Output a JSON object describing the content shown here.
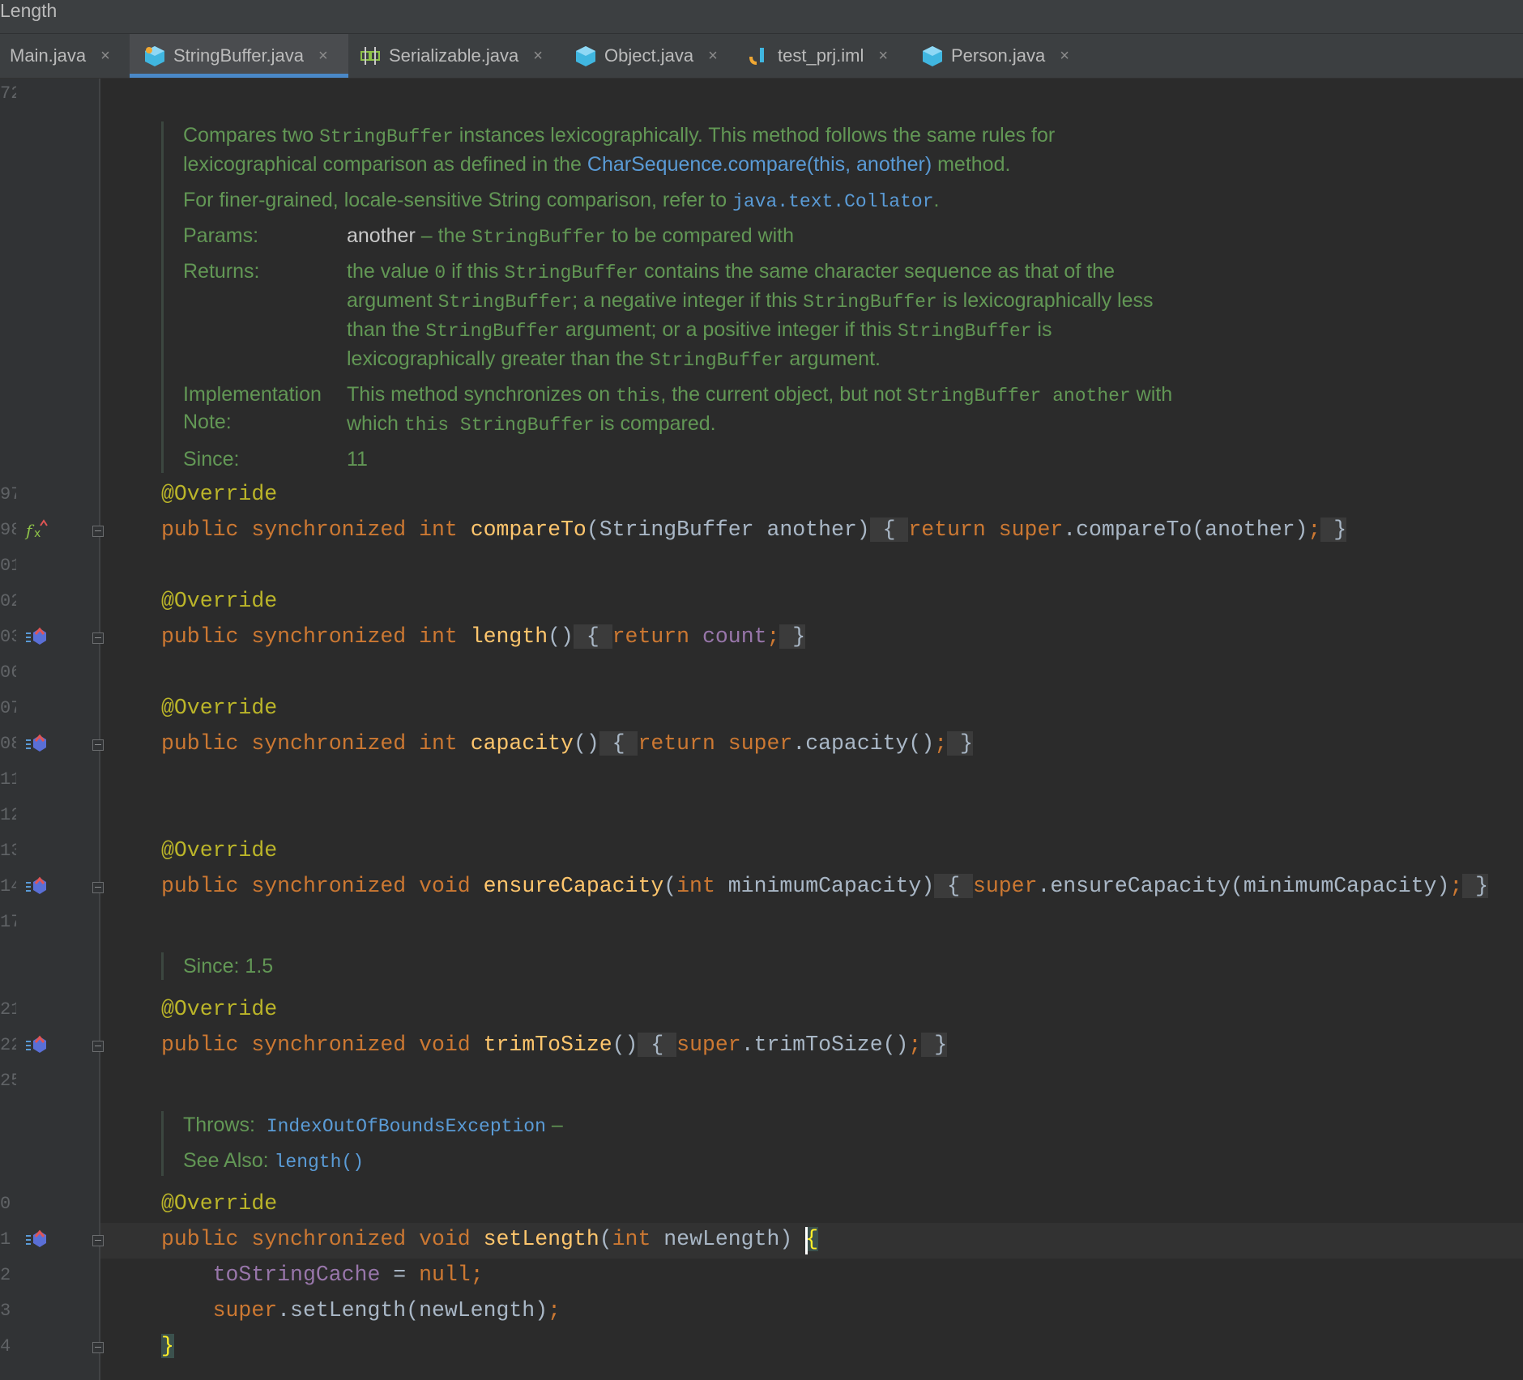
{
  "window": {
    "breadcrumb": "Length"
  },
  "tabs": [
    {
      "label": "Main.java",
      "icon": "java-class-icon",
      "active": false
    },
    {
      "label": "StringBuffer.java",
      "icon": "java-class-icon",
      "active": true
    },
    {
      "label": "Serializable.java",
      "icon": "interface-icon",
      "active": false
    },
    {
      "label": "Object.java",
      "icon": "java-class-icon",
      "active": false
    },
    {
      "label": "test_prj.iml",
      "icon": "iml-file-icon",
      "active": false
    },
    {
      "label": "Person.java",
      "icon": "java-class-icon",
      "active": false
    }
  ],
  "close_glyph": "×",
  "gutter": {
    "line_numbers": [
      "72",
      "97",
      "98",
      "01",
      "02",
      "03",
      "06",
      "07",
      "08",
      "11",
      "12",
      "13",
      "14",
      "17",
      "21",
      "22",
      "25",
      "0",
      "1",
      "2",
      "3",
      "4"
    ]
  },
  "doc1": {
    "para1_a": "Compares two ",
    "para1_b": "StringBuffer",
    "para1_c": " instances lexicographically. This method follows the same rules for lexicographical comparison as defined in the ",
    "para1_link": "CharSequence.compare(this, another)",
    "para1_d": " method.",
    "para2_a": "For finer-grained, locale-sensitive String comparison, refer to ",
    "para2_link": "java.text.Collator",
    "para2_b": ".",
    "params_label": "Params:",
    "param_name": "another",
    "param_a": " – the ",
    "param_b": "StringBuffer",
    "param_c": " to be compared with",
    "returns_label": "Returns:",
    "returns_1": "the value ",
    "returns_2": "0",
    "returns_3": " if this ",
    "returns_4": "StringBuffer",
    "returns_5": " contains the same character sequence as that of the argument ",
    "returns_6": "StringBuffer",
    "returns_7": "; a negative integer if this ",
    "returns_8": "StringBuffer",
    "returns_9": " is lexicographically less than the ",
    "returns_10": "StringBuffer",
    "returns_11": " argument; or a positive integer if this ",
    "returns_12": "StringBuffer",
    "returns_13": " is lexicographically greater than the ",
    "returns_14": "StringBuffer",
    "returns_15": " argument.",
    "impl_label_1": "Implementation",
    "impl_label_2": "Note:",
    "impl_1": "This method synchronizes on ",
    "impl_2": "this",
    "impl_3": ", the current object, but not ",
    "impl_4": "StringBuffer another",
    "impl_5": " with which ",
    "impl_6": "this StringBuffer",
    "impl_7": " is compared.",
    "since_label": "Since:",
    "since_value": "11"
  },
  "doc2": {
    "text": "Since: 1.5"
  },
  "doc3": {
    "throws_label": "Throws:",
    "throws_link": "IndexOutOfBoundsException",
    "throws_dash": " –",
    "see_label": "See Also:",
    "see_link": "length()"
  },
  "code": {
    "override": "@Override",
    "public": "public",
    "synchronized": "synchronized",
    "int": "int",
    "void": "void",
    "return": "return",
    "super": "super",
    "null": "null",
    "m1_name": "compareTo",
    "m1_params": "(StringBuffer another)",
    "m1_body_a": " { ",
    "m1_body_b": ".compareTo(another)",
    "m1_semi": ";",
    "m1_close": " }",
    "m2_name": "length",
    "m2_params": "()",
    "m2_field": "count",
    "m3_name": "capacity",
    "m3_params": "()",
    "m3_call": ".capacity()",
    "m4_name": "ensureCapacity",
    "m4_params_a": "(",
    "m4_params_b": " minimumCapacity)",
    "m4_call": ".ensureCapacity(minimumCapacity)",
    "m5_name": "trimToSize",
    "m5_params": "()",
    "m5_call": ".trimToSize()",
    "m6_name": "setLength",
    "m6_params_a": "(",
    "m6_params_b": " newLength) ",
    "m6_open": "{",
    "m6_line1_field": "toStringCache",
    "m6_line1_eq": " = ",
    "m6_line2_call": ".setLength(newLength)",
    "m6_close": "}"
  },
  "colors": {
    "background": "#2b2b2b",
    "keyword": "#cc7832",
    "annotation": "#bbb529",
    "method": "#ffc66d",
    "field": "#9876aa",
    "doc_text": "#629755",
    "doc_link": "#5a9bd6",
    "tab_underline": "#4a88c7"
  }
}
